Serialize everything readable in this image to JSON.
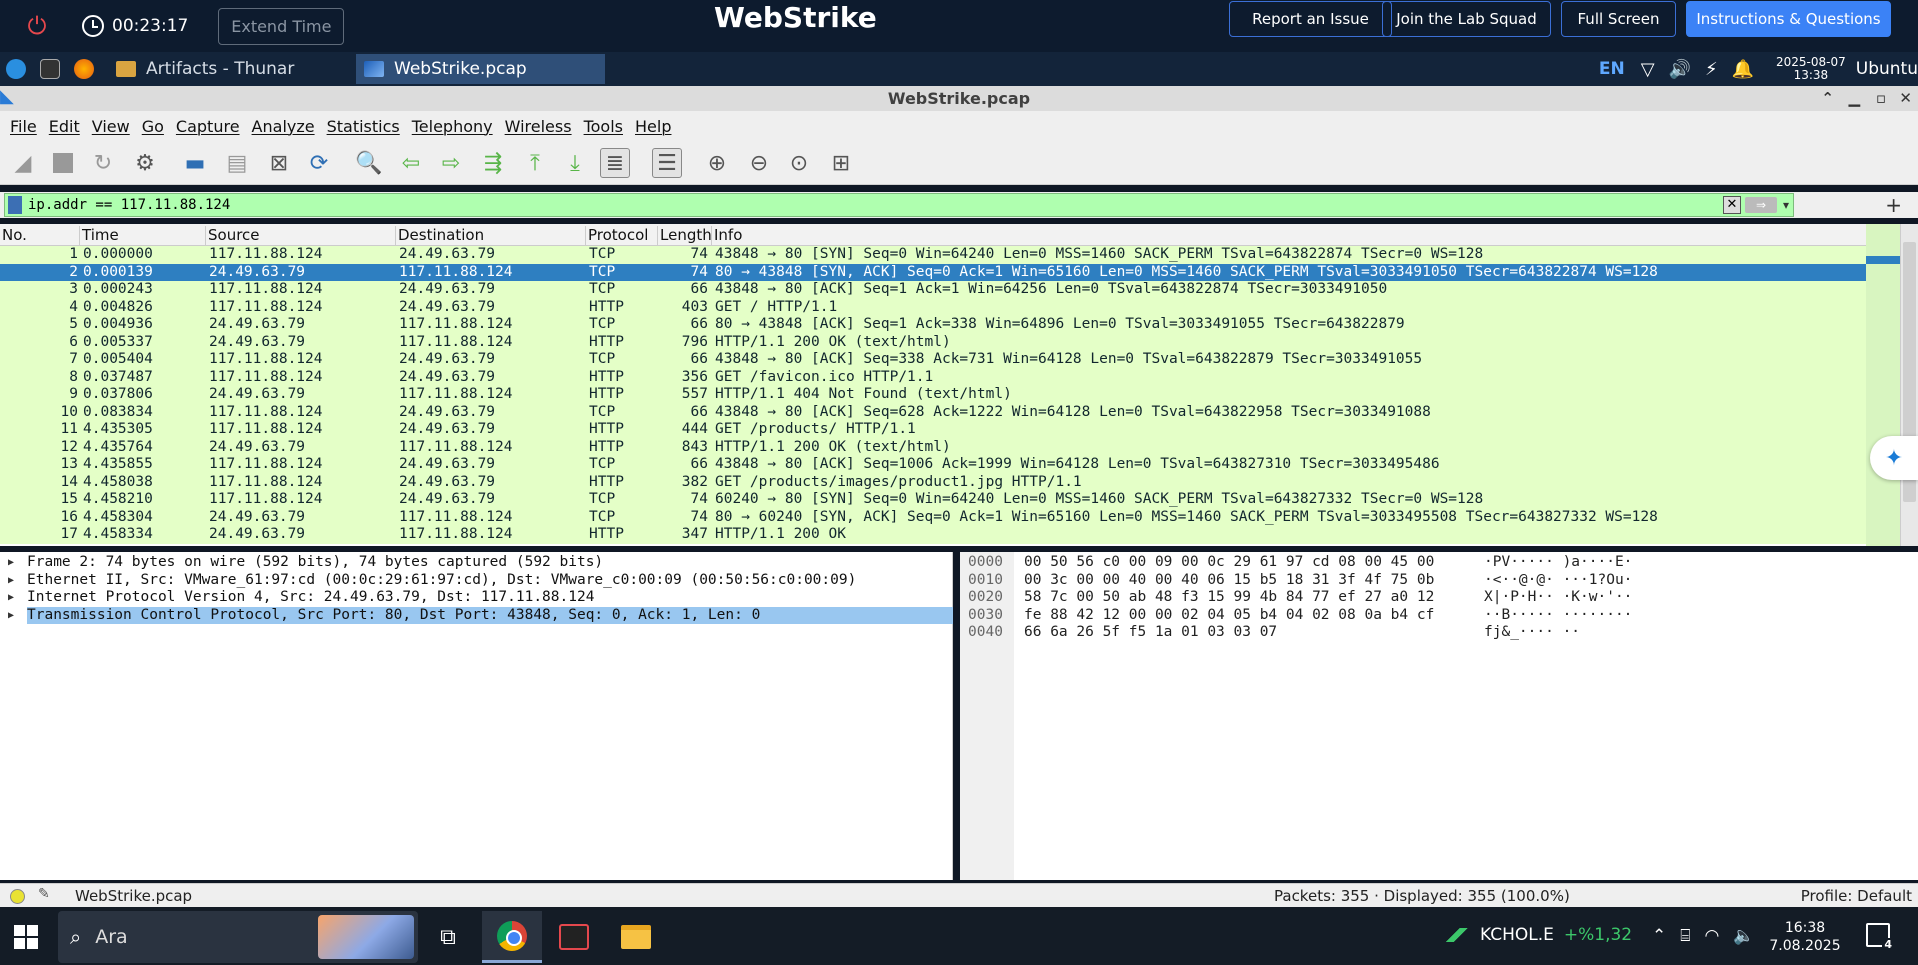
{
  "lab": {
    "timer": "00:23:17",
    "extend_label": "Extend Time",
    "brand": "WebStrike",
    "buttons": [
      "Report an Issue",
      "Join the Lab Squad",
      "Full Screen",
      "Instructions & Questions"
    ]
  },
  "ubuntu_panel": {
    "tasks": [
      "Artifacts - Thunar",
      "WebStrike.pcap"
    ],
    "lang": "EN",
    "date": "2025-08-07",
    "time": "13:38",
    "user": "Ubuntu"
  },
  "window_title": "WebStrike.pcap",
  "menu": [
    "File",
    "Edit",
    "View",
    "Go",
    "Capture",
    "Analyze",
    "Statistics",
    "Telephony",
    "Wireless",
    "Tools",
    "Help"
  ],
  "filter": {
    "value": "ip.addr == 117.11.88.124"
  },
  "columns": [
    "No.",
    "Time",
    "Source",
    "Destination",
    "Protocol",
    "Length",
    "Info"
  ],
  "packets": [
    {
      "no": "1",
      "time": "0.000000",
      "src": "117.11.88.124",
      "dst": "24.49.63.79",
      "proto": "TCP",
      "len": "74",
      "info": "43848 → 80 [SYN] Seq=0 Win=64240 Len=0 MSS=1460 SACK_PERM TSval=643822874 TSecr=0 WS=128"
    },
    {
      "no": "2",
      "time": "0.000139",
      "src": "24.49.63.79",
      "dst": "117.11.88.124",
      "proto": "TCP",
      "len": "74",
      "info": "80 → 43848 [SYN, ACK] Seq=0 Ack=1 Win=65160 Len=0 MSS=1460 SACK_PERM TSval=3033491050 TSecr=643822874 WS=128"
    },
    {
      "no": "3",
      "time": "0.000243",
      "src": "117.11.88.124",
      "dst": "24.49.63.79",
      "proto": "TCP",
      "len": "66",
      "info": "43848 → 80 [ACK] Seq=1 Ack=1 Win=64256 Len=0 TSval=643822874 TSecr=3033491050"
    },
    {
      "no": "4",
      "time": "0.004826",
      "src": "117.11.88.124",
      "dst": "24.49.63.79",
      "proto": "HTTP",
      "len": "403",
      "info": "GET / HTTP/1.1"
    },
    {
      "no": "5",
      "time": "0.004936",
      "src": "24.49.63.79",
      "dst": "117.11.88.124",
      "proto": "TCP",
      "len": "66",
      "info": "80 → 43848 [ACK] Seq=1 Ack=338 Win=64896 Len=0 TSval=3033491055 TSecr=643822879"
    },
    {
      "no": "6",
      "time": "0.005337",
      "src": "24.49.63.79",
      "dst": "117.11.88.124",
      "proto": "HTTP",
      "len": "796",
      "info": "HTTP/1.1 200 OK  (text/html)"
    },
    {
      "no": "7",
      "time": "0.005404",
      "src": "117.11.88.124",
      "dst": "24.49.63.79",
      "proto": "TCP",
      "len": "66",
      "info": "43848 → 80 [ACK] Seq=338 Ack=731 Win=64128 Len=0 TSval=643822879 TSecr=3033491055"
    },
    {
      "no": "8",
      "time": "0.037487",
      "src": "117.11.88.124",
      "dst": "24.49.63.79",
      "proto": "HTTP",
      "len": "356",
      "info": "GET /favicon.ico HTTP/1.1"
    },
    {
      "no": "9",
      "time": "0.037806",
      "src": "24.49.63.79",
      "dst": "117.11.88.124",
      "proto": "HTTP",
      "len": "557",
      "info": "HTTP/1.1 404 Not Found  (text/html)"
    },
    {
      "no": "10",
      "time": "0.083834",
      "src": "117.11.88.124",
      "dst": "24.49.63.79",
      "proto": "TCP",
      "len": "66",
      "info": "43848 → 80 [ACK] Seq=628 Ack=1222 Win=64128 Len=0 TSval=643822958 TSecr=3033491088"
    },
    {
      "no": "11",
      "time": "4.435305",
      "src": "117.11.88.124",
      "dst": "24.49.63.79",
      "proto": "HTTP",
      "len": "444",
      "info": "GET /products/ HTTP/1.1"
    },
    {
      "no": "12",
      "time": "4.435764",
      "src": "24.49.63.79",
      "dst": "117.11.88.124",
      "proto": "HTTP",
      "len": "843",
      "info": "HTTP/1.1 200 OK  (text/html)"
    },
    {
      "no": "13",
      "time": "4.435855",
      "src": "117.11.88.124",
      "dst": "24.49.63.79",
      "proto": "TCP",
      "len": "66",
      "info": "43848 → 80 [ACK] Seq=1006 Ack=1999 Win=64128 Len=0 TSval=643827310 TSecr=3033495486"
    },
    {
      "no": "14",
      "time": "4.458038",
      "src": "117.11.88.124",
      "dst": "24.49.63.79",
      "proto": "HTTP",
      "len": "382",
      "info": "GET /products/images/product1.jpg HTTP/1.1"
    },
    {
      "no": "15",
      "time": "4.458210",
      "src": "117.11.88.124",
      "dst": "24.49.63.79",
      "proto": "TCP",
      "len": "74",
      "info": "60240 → 80 [SYN] Seq=0 Win=64240 Len=0 MSS=1460 SACK_PERM TSval=643827332 TSecr=0 WS=128"
    },
    {
      "no": "16",
      "time": "4.458304",
      "src": "24.49.63.79",
      "dst": "117.11.88.124",
      "proto": "TCP",
      "len": "74",
      "info": "80 → 60240 [SYN, ACK] Seq=0 Ack=1 Win=65160 Len=0 MSS=1460 SACK_PERM TSval=3033495508 TSecr=643827332 WS=128"
    },
    {
      "no": "17",
      "time": "4.458334",
      "src": "24.49.63.79",
      "dst": "117.11.88.124",
      "proto": "HTTP",
      "len": "347",
      "info": "HTTP/1.1 200 OK"
    }
  ],
  "selected_packet": "2",
  "details": [
    "Frame 2: 74 bytes on wire (592 bits), 74 bytes captured (592 bits)",
    "Ethernet II, Src: VMware_61:97:cd (00:0c:29:61:97:cd), Dst: VMware_c0:00:09 (00:50:56:c0:00:09)",
    "Internet Protocol Version 4, Src: 24.49.63.79, Dst: 117.11.88.124",
    "Transmission Control Protocol, Src Port: 80, Dst Port: 43848, Seq: 0, Ack: 1, Len: 0"
  ],
  "bytes": [
    {
      "off": "0000",
      "hex": "00 50 56 c0 00 09 00 0c  29 61 97 cd 08 00 45 00",
      "ascii": "·PV····· )a····E·"
    },
    {
      "off": "0010",
      "hex": "00 3c 00 00 40 00 40 06  15 b5 18 31 3f 4f 75 0b",
      "ascii": "·<··@·@· ···1?Ou·"
    },
    {
      "off": "0020",
      "hex": "58 7c 00 50 ab 48 f3 15  99 4b 84 77 ef 27 a0 12",
      "ascii": "X|·P·H·· ·K·w·'··"
    },
    {
      "off": "0030",
      "hex": "fe 88 42 12 00 00 02 04  05 b4 04 02 08 0a b4 cf",
      "ascii": "··B····· ········"
    },
    {
      "off": "0040",
      "hex": "66 6a 26 5f f5 1a 01 03  03 07",
      "ascii": "fj&_···· ··"
    }
  ],
  "status": {
    "file": "WebStrike.pcap",
    "packets": "Packets: 355 · Displayed: 355 (100.0%)",
    "profile": "Profile: Default"
  },
  "taskbar": {
    "search_placeholder": "Ara",
    "stock_name": "KCHOL.E",
    "stock_change": "+%1,32",
    "time": "16:38",
    "date": "7.08.2025",
    "notif_count": "4"
  },
  "colors": {
    "tcp_row": "#e4ffc7",
    "selected_row": "#2e7fc1",
    "filter_bg": "#afffaf",
    "lab_primary": "#3b82f6"
  }
}
